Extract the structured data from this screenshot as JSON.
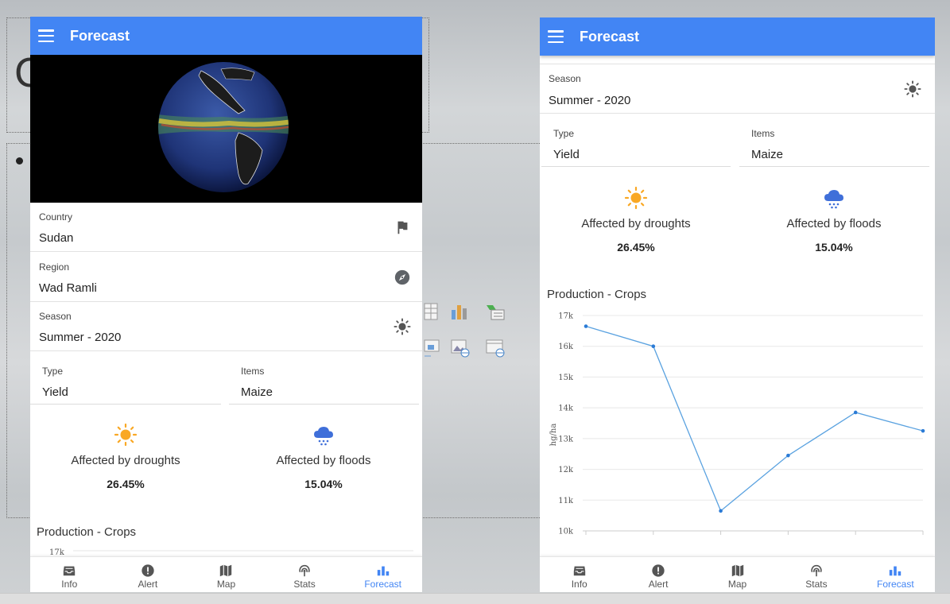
{
  "colors": {
    "primary": "#4285f4",
    "sun": "#f9a825",
    "rain": "#3f6fd9",
    "line": "#5aa2e0"
  },
  "left_phone": {
    "appbar": {
      "title": "Forecast",
      "menu_icon": "menu-icon"
    },
    "fields": {
      "country": {
        "label": "Country",
        "value": "Sudan",
        "icon": "flag-icon"
      },
      "region": {
        "label": "Region",
        "value": "Wad Ramli",
        "icon": "compass-icon"
      },
      "season": {
        "label": "Season",
        "value": "Summer - 2020",
        "icon": "sun-icon"
      },
      "type": {
        "label": "Type",
        "value": "Yield"
      },
      "items": {
        "label": "Items",
        "value": "Maize"
      }
    },
    "droughts": {
      "label": "Affected by droughts",
      "value": "26.45%",
      "icon": "sun-icon"
    },
    "floods": {
      "label": "Affected by floods",
      "value": "15.04%",
      "icon": "rain-cloud-icon"
    },
    "production_title": "Production - Crops",
    "partial_tick": "17k"
  },
  "right_phone": {
    "appbar": {
      "title": "Forecast",
      "menu_icon": "menu-icon"
    },
    "fields": {
      "season": {
        "label": "Season",
        "value": "Summer - 2020",
        "icon": "sun-icon"
      },
      "type": {
        "label": "Type",
        "value": "Yield"
      },
      "items": {
        "label": "Items",
        "value": "Maize"
      }
    },
    "droughts": {
      "label": "Affected by droughts",
      "value": "26.45%",
      "icon": "sun-icon"
    },
    "floods": {
      "label": "Affected by floods",
      "value": "15.04%",
      "icon": "rain-cloud-icon"
    },
    "production_title": "Production - Crops"
  },
  "bottom_nav": [
    {
      "label": "Info",
      "icon": "inbox-icon",
      "active": false
    },
    {
      "label": "Alert",
      "icon": "alert-icon",
      "active": false
    },
    {
      "label": "Map",
      "icon": "map-icon",
      "active": false
    },
    {
      "label": "Stats",
      "icon": "stats-icon",
      "active": false
    },
    {
      "label": "Forecast",
      "icon": "bar-chart-icon",
      "active": true
    }
  ],
  "chart_data": {
    "type": "line",
    "title": "Production - Crops",
    "ylabel": "hg/ha",
    "xlabel": "",
    "ylim": [
      10000,
      17000
    ],
    "y_ticks": [
      "10k",
      "11k",
      "12k",
      "13k",
      "14k",
      "15k",
      "16k",
      "17k"
    ],
    "series": [
      {
        "values": [
          16650,
          16000,
          10650,
          12450,
          13850,
          13250
        ]
      }
    ],
    "grid": true
  }
}
